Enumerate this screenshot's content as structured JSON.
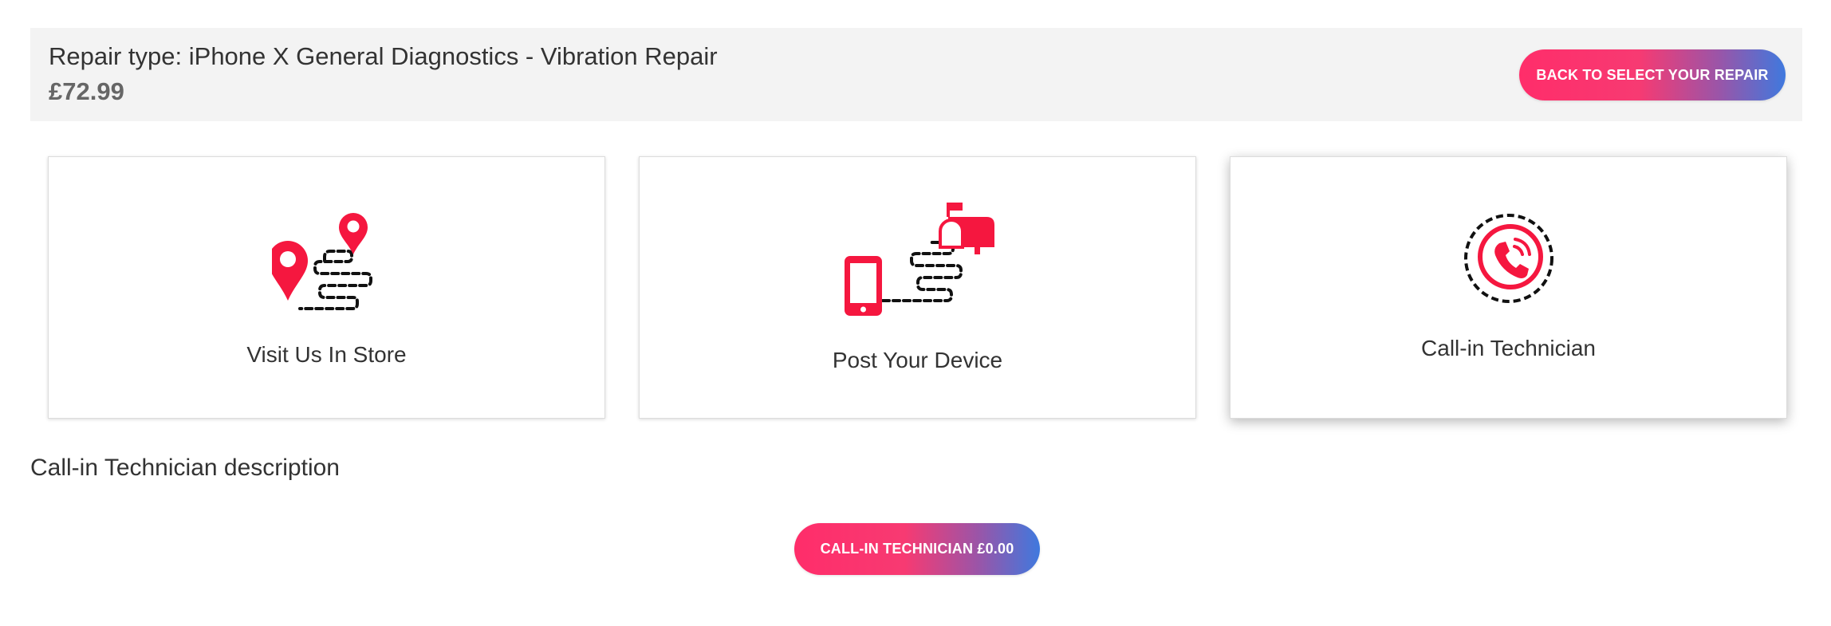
{
  "header": {
    "repair_type": "Repair type: iPhone X General Diagnostics - Vibration Repair",
    "price": "£72.99",
    "back_button": "BACK TO SELECT YOUR REPAIR"
  },
  "options": [
    {
      "label": "Visit Us In Store",
      "icon": "map-route-icon",
      "selected": false
    },
    {
      "label": "Post Your Device",
      "icon": "phone-to-mailbox-icon",
      "selected": false
    },
    {
      "label": "Call-in Technician",
      "icon": "phone-call-icon",
      "selected": true
    }
  ],
  "description": "Call-in Technician description",
  "action_button": "CALL-IN TECHNICIAN £0.00",
  "colors": {
    "accent_red": "#f5173f",
    "gradient_start": "#ff2d6a",
    "gradient_end": "#3f79de",
    "header_bg": "#f3f3f3"
  }
}
